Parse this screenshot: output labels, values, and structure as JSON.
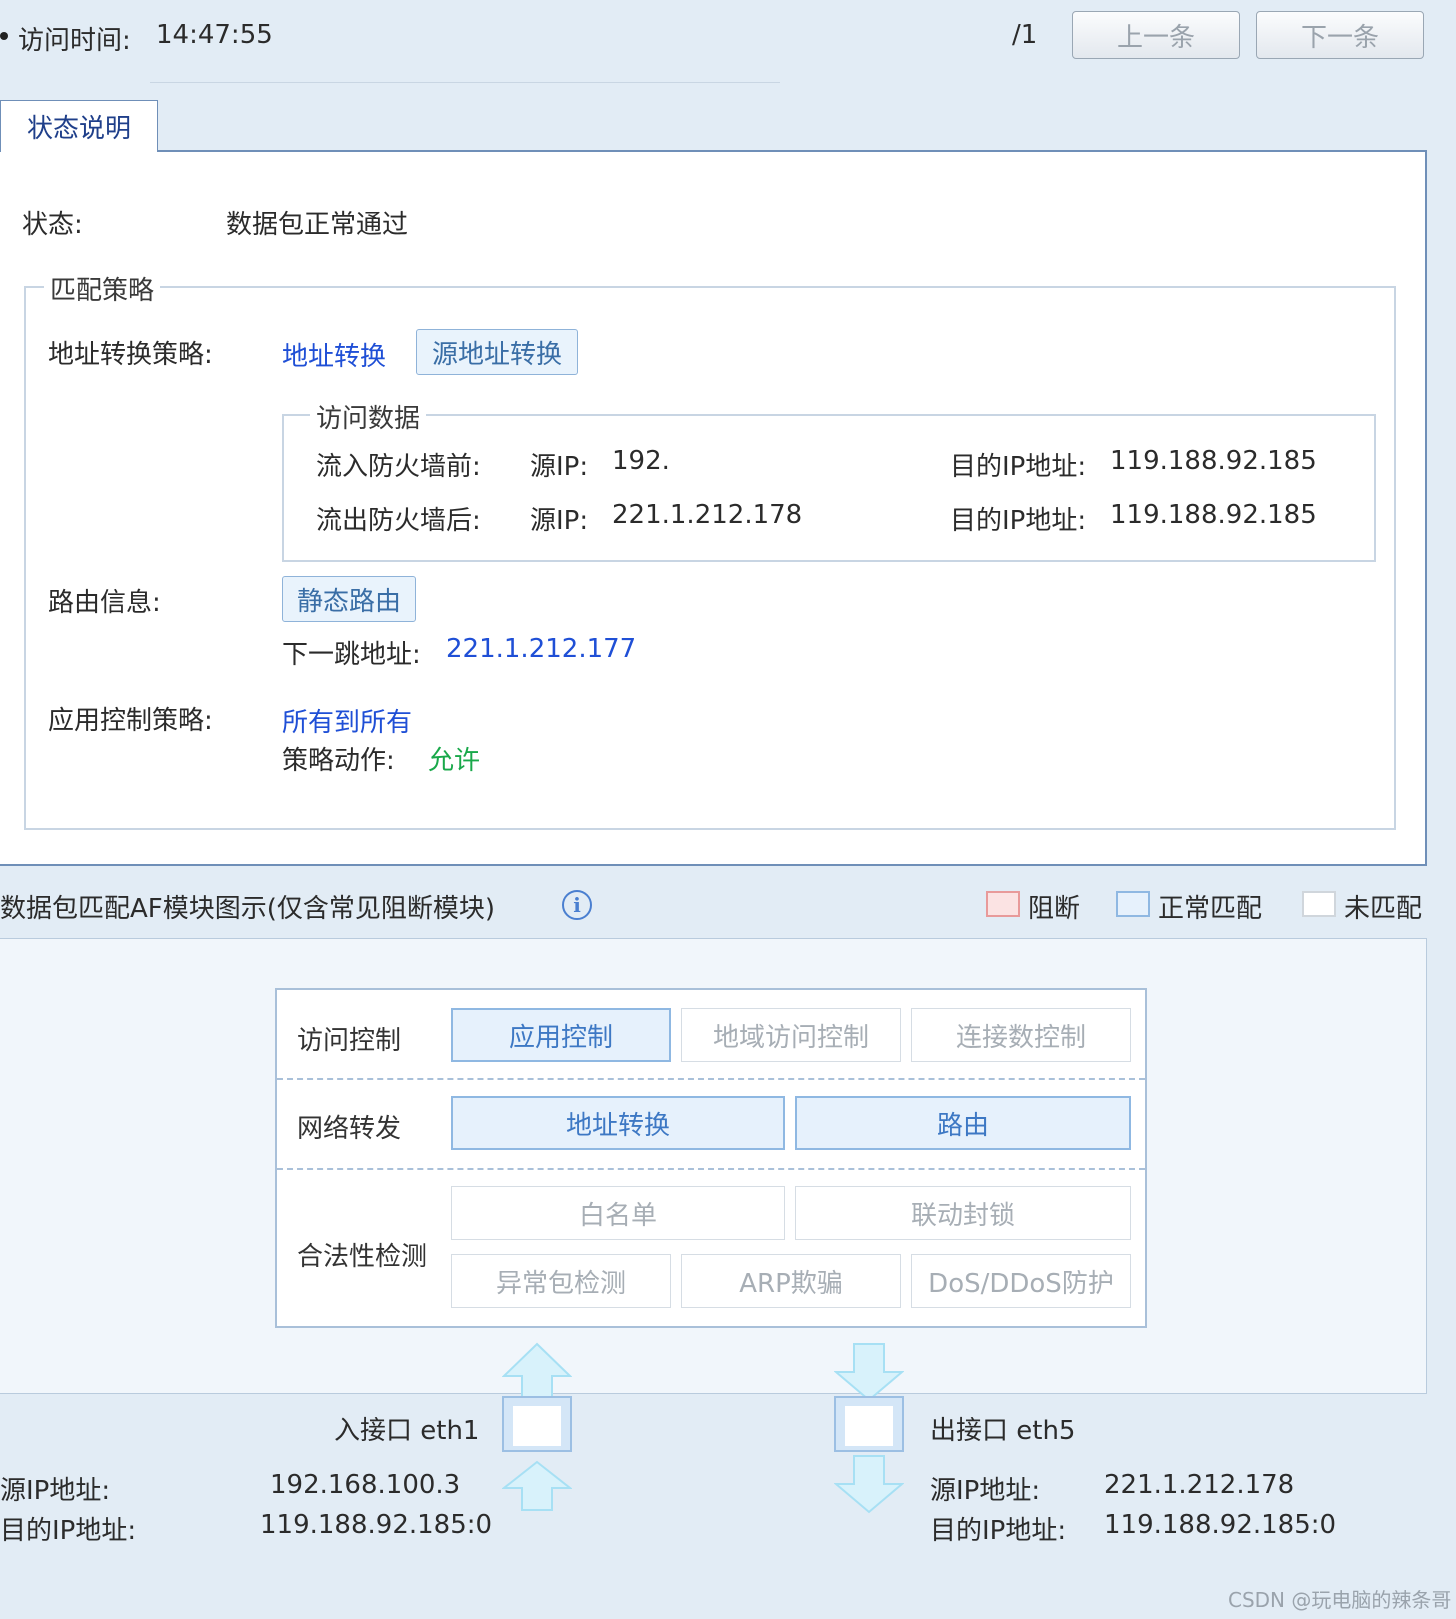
{
  "header": {
    "visit_time_label": "访问时间:",
    "visit_time_value": "14:47:55",
    "page_indicator": "/1",
    "prev_label": "上一条",
    "next_label": "下一条"
  },
  "tab": {
    "label": "状态说明"
  },
  "status": {
    "label": "状态:",
    "value": "数据包正常通过"
  },
  "policy": {
    "legend": "匹配策略",
    "nat_label": "地址转换策略:",
    "nat_link": "地址转换",
    "nat_tag": "源地址转换",
    "access_data": {
      "legend": "访问数据",
      "rows": [
        {
          "stage": "流入防火墙前:",
          "src_label": "源IP:",
          "src_value": "192.",
          "dst_label": "目的IP地址:",
          "dst_value": "119.188.92.185"
        },
        {
          "stage": "流出防火墙后:",
          "src_label": "源IP:",
          "src_value": "221.1.212.178",
          "dst_label": "目的IP地址:",
          "dst_value": "119.188.92.185"
        }
      ]
    },
    "route_label": "路由信息:",
    "route_tag": "静态路由",
    "next_hop_label": "下一跳地址:",
    "next_hop_value": "221.1.212.177",
    "app_label": "应用控制策略:",
    "app_link": "所有到所有",
    "action_label": "策略动作:",
    "action_value": "允许"
  },
  "diagram": {
    "title": "数据包匹配AF模块图示(仅含常见阻断模块)",
    "legend": [
      {
        "label": "阻断",
        "color": "#fbe3e3",
        "border": "#e89a9a"
      },
      {
        "label": "正常匹配",
        "color": "#e6f1fc",
        "border": "#8fb8e2"
      },
      {
        "label": "未匹配",
        "color": "#ffffff",
        "border": "#d0d6dc"
      }
    ],
    "rows": [
      {
        "label": "访问控制",
        "modules": [
          {
            "name": "应用控制",
            "matched": true
          },
          {
            "name": "地域访问控制",
            "matched": false
          },
          {
            "name": "连接数控制",
            "matched": false
          }
        ]
      },
      {
        "label": "网络转发",
        "modules": [
          {
            "name": "地址转换",
            "matched": true
          },
          {
            "name": "路由",
            "matched": true
          }
        ]
      },
      {
        "label": "合法性检测",
        "modules": [
          {
            "name": "白名单",
            "matched": false
          },
          {
            "name": "联动封锁",
            "matched": false
          },
          {
            "name": "异常包检测",
            "matched": false
          },
          {
            "name": "ARP欺骗",
            "matched": false
          },
          {
            "name": "DoS/DDoS防护",
            "matched": false
          }
        ]
      }
    ]
  },
  "interfaces": {
    "in": {
      "label": "入接口 eth1",
      "src_label": "源IP地址:",
      "src_value": "192.168.100.3",
      "dst_label": "目的IP地址:",
      "dst_value": "119.188.92.185:0"
    },
    "out": {
      "label": "出接口 eth5",
      "src_label": "源IP地址:",
      "src_value": "221.1.212.178",
      "dst_label": "目的IP地址:",
      "dst_value": "119.188.92.185:0"
    }
  },
  "watermark": "CSDN @玩电脑的辣条哥"
}
